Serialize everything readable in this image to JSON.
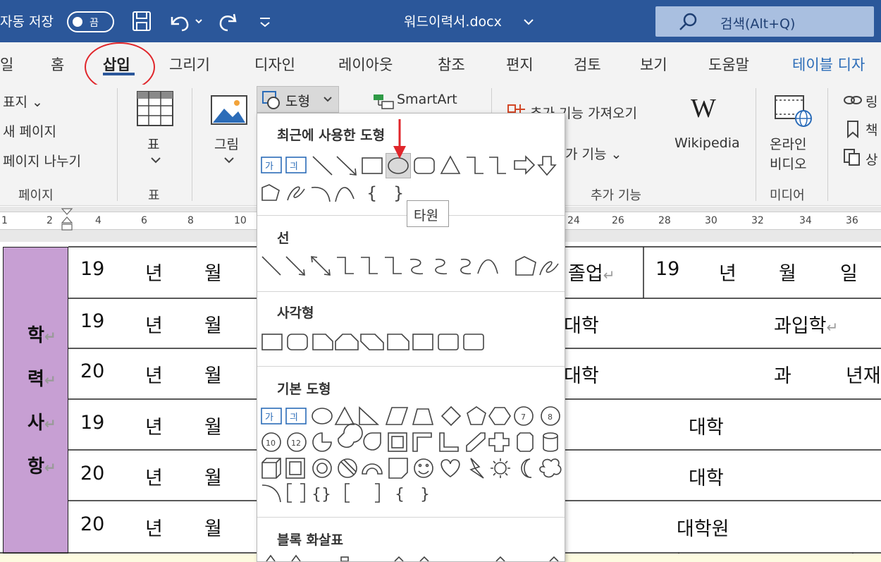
{
  "titlebar": {
    "autosave_label": "자동 저장",
    "autosave_state": "끔",
    "document_title": "워드이력서.docx",
    "search_placeholder": "검색(Alt+Q)"
  },
  "tabs": [
    "일",
    "홈",
    "삽입",
    "그리기",
    "디자인",
    "레이아웃",
    "참조",
    "편지",
    "검토",
    "보기",
    "도움말",
    "테이블 디자"
  ],
  "active_tab": "삽입",
  "ribbon": {
    "pages_group": {
      "items": [
        "표지 ⌄",
        "새 페이지",
        "페이지 나누기"
      ],
      "label": "페이지"
    },
    "table_group": {
      "button": "표",
      "label": "표"
    },
    "picture_button": "그림",
    "shapes_button": "도형",
    "smartart_button": "SmartArt",
    "addins": {
      "get_addins": "추가 기능 가져오기",
      "my_addins": "가 기능 ⌄",
      "wikipedia": "Wikipedia",
      "label": "추가 기능"
    },
    "media": {
      "online_video_1": "온라인",
      "online_video_2": "비디오",
      "label": "미디어"
    },
    "links": {
      "link": "링",
      "bookmark": "책",
      "crossref": "상"
    }
  },
  "ruler": [
    "1",
    "2",
    "4",
    "6",
    "8",
    "10",
    "24",
    "26",
    "28",
    "30",
    "32",
    "34",
    "36"
  ],
  "shapes_gallery": {
    "sections": [
      "최근에 사용한 도형",
      "선",
      "사각형",
      "기본 도형",
      "블록 화살표"
    ],
    "tooltip": "타원"
  },
  "document": {
    "side_header": [
      "학",
      "력",
      "사",
      "항"
    ],
    "rows": [
      {
        "year": "19",
        "y": "년",
        "m": "월",
        "right": "졸업",
        "right2": "19",
        "right3": "년",
        "right4": "월",
        "right5": "일"
      },
      {
        "year": "19",
        "y": "년",
        "m": "월",
        "right": "대학",
        "right2": "과입학"
      },
      {
        "year": "20",
        "y": "년",
        "m": "월",
        "right": "대학",
        "right2": "과",
        "right3": "년재"
      },
      {
        "year": "19",
        "y": "년",
        "m": "월",
        "right": "대학"
      },
      {
        "year": "20",
        "y": "년",
        "m": "월",
        "right": "대학"
      },
      {
        "year": "20",
        "y": "년",
        "m": "월",
        "right": "대학원"
      }
    ]
  },
  "colors": {
    "titlebar": "#2b579a",
    "side_header": "#c79fd3",
    "highlight_circle": "#e0262b"
  }
}
